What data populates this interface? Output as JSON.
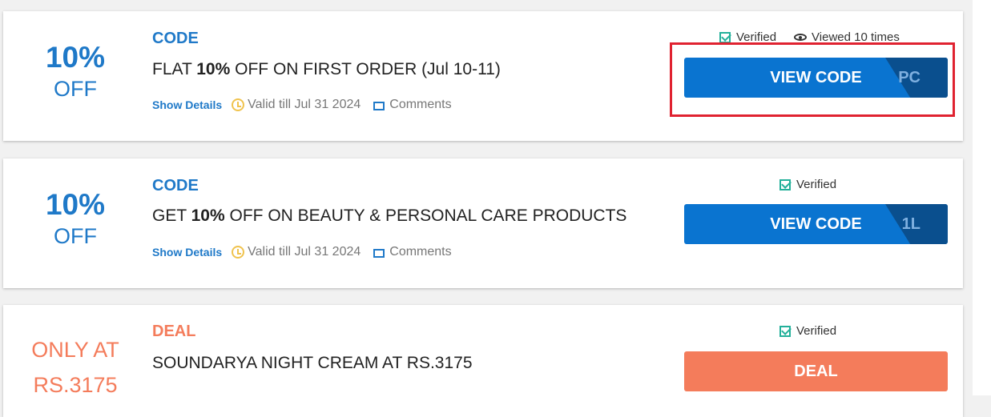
{
  "offers": [
    {
      "discount_big": "10%",
      "discount_small": "OFF",
      "type": "CODE",
      "title_pre": "FLAT ",
      "title_bold": "10%",
      "title_post": " OFF ON FIRST ORDER (Jul 10-11)",
      "show_details": "Show Details",
      "valid": "Valid till Jul 31 2024",
      "comments": "Comments",
      "verified": "Verified",
      "viewed": "Viewed 10 times",
      "button_label": "VIEW CODE",
      "code_peek": "PC"
    },
    {
      "discount_big": "10%",
      "discount_small": "OFF",
      "type": "CODE",
      "title_pre": "GET ",
      "title_bold": "10%",
      "title_post": " OFF ON BEAUTY & PERSONAL CARE PRODUCTS",
      "show_details": "Show Details",
      "valid": "Valid till Jul 31 2024",
      "comments": "Comments",
      "verified": "Verified",
      "button_label": "VIEW CODE",
      "code_peek": "1L"
    },
    {
      "discount_line1": "ONLY AT",
      "discount_line2": "RS.3175",
      "type": "DEAL",
      "title": "SOUNDARYA NIGHT CREAM AT RS.3175",
      "verified": "Verified",
      "button_label": "DEAL"
    }
  ],
  "colors": {
    "accent": "#1f79c8",
    "deal": "#f47c5b",
    "button": "#0a74d0",
    "verified": "#23b09a",
    "highlight": "#e02230"
  }
}
